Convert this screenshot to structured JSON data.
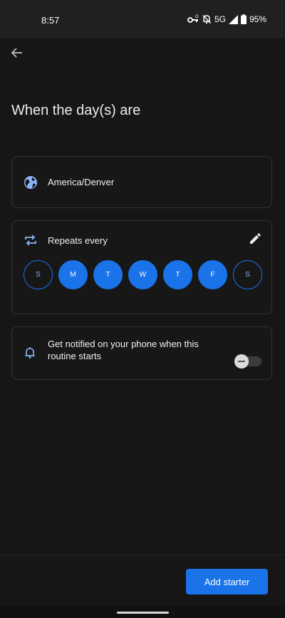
{
  "status_bar": {
    "time": "8:57",
    "network": "5G",
    "battery": "95%",
    "icons": [
      "vpn-key-icon",
      "bell-off-icon",
      "signal-icon",
      "battery-icon"
    ]
  },
  "header": {
    "back_icon": "arrow-left-icon",
    "title": "When the day(s) are"
  },
  "timezone": {
    "icon": "globe-icon",
    "label": "America/Denver"
  },
  "repeat": {
    "icon": "repeat-icon",
    "label": "Repeats every",
    "edit_icon": "pencil-icon",
    "days": [
      {
        "label": "S",
        "selected": false
      },
      {
        "label": "M",
        "selected": true
      },
      {
        "label": "T",
        "selected": true
      },
      {
        "label": "W",
        "selected": true
      },
      {
        "label": "T",
        "selected": true
      },
      {
        "label": "F",
        "selected": true
      },
      {
        "label": "S",
        "selected": false
      }
    ]
  },
  "notify": {
    "icon": "bell-icon",
    "text": "Get notified on your phone when this routine starts",
    "enabled": false
  },
  "footer": {
    "add_button_label": "Add starter"
  },
  "colors": {
    "accent": "#1a73e8",
    "background": "#161616",
    "card_border": "#333333"
  }
}
